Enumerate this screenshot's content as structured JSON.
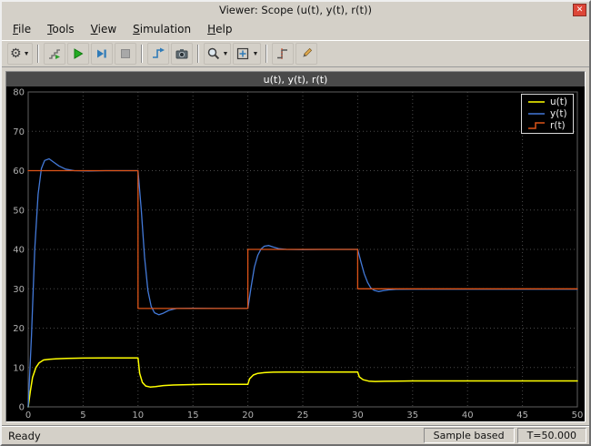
{
  "window": {
    "title": "Viewer: Scope (u(t), y(t), r(t))",
    "close_glyph": "✕"
  },
  "menu": {
    "items": [
      "File",
      "Tools",
      "View",
      "Simulation",
      "Help"
    ]
  },
  "toolbar": {
    "icons": [
      "settings-gear",
      "stepping-options",
      "run",
      "step-forward",
      "stop",
      "highlight-signal",
      "snapshot-camera",
      "zoom",
      "fit-to-view",
      "trigger",
      "cursor-measurements"
    ]
  },
  "chart_data": {
    "type": "line",
    "title": "u(t), y(t), r(t)",
    "xlim": [
      0,
      50
    ],
    "ylim": [
      0,
      80
    ],
    "xticks": [
      0,
      5,
      10,
      15,
      20,
      25,
      30,
      35,
      40,
      45,
      50
    ],
    "yticks": [
      0,
      10,
      20,
      30,
      40,
      50,
      60,
      70,
      80
    ],
    "grid": true,
    "legend_position": "top-right",
    "grid_color": "#4a4a4a",
    "tick_color": "#b0b0b0",
    "frame_color": "#5f5f5f",
    "background": "#000000",
    "series": [
      {
        "name": "u(t)",
        "color": "#ffff00",
        "width": 1.5,
        "legend_sample": "line",
        "points": [
          [
            0,
            0
          ],
          [
            0.2,
            4
          ],
          [
            0.4,
            7.5
          ],
          [
            0.7,
            10
          ],
          [
            1,
            11.2
          ],
          [
            1.4,
            11.9
          ],
          [
            1.9,
            12.1
          ],
          [
            2.5,
            12.2
          ],
          [
            3.5,
            12.3
          ],
          [
            5,
            12.4
          ],
          [
            7,
            12.45
          ],
          [
            10,
            12.45
          ],
          [
            10.15,
            8.5
          ],
          [
            10.4,
            6.2
          ],
          [
            10.7,
            5.3
          ],
          [
            11.1,
            5.05
          ],
          [
            11.6,
            5.15
          ],
          [
            12.3,
            5.4
          ],
          [
            13.2,
            5.55
          ],
          [
            14.5,
            5.65
          ],
          [
            16,
            5.7
          ],
          [
            20,
            5.7
          ],
          [
            20.15,
            7.1
          ],
          [
            20.5,
            8.1
          ],
          [
            20.9,
            8.5
          ],
          [
            21.5,
            8.7
          ],
          [
            22.3,
            8.8
          ],
          [
            23.5,
            8.85
          ],
          [
            26,
            8.85
          ],
          [
            30,
            8.85
          ],
          [
            30.15,
            7.6
          ],
          [
            30.5,
            6.9
          ],
          [
            31,
            6.55
          ],
          [
            31.6,
            6.45
          ],
          [
            32.4,
            6.5
          ],
          [
            33.5,
            6.55
          ],
          [
            35,
            6.6
          ],
          [
            40,
            6.6
          ],
          [
            45,
            6.6
          ],
          [
            50,
            6.6
          ]
        ]
      },
      {
        "name": "y(t)",
        "color": "#4379d8",
        "width": 1.3,
        "legend_sample": "line",
        "points": [
          [
            0,
            0
          ],
          [
            0.3,
            18
          ],
          [
            0.6,
            40
          ],
          [
            0.9,
            54
          ],
          [
            1.2,
            60.5
          ],
          [
            1.5,
            62.6
          ],
          [
            1.9,
            63
          ],
          [
            2.3,
            62.2
          ],
          [
            2.8,
            61.2
          ],
          [
            3.4,
            60.4
          ],
          [
            4.2,
            60
          ],
          [
            5.5,
            59.9
          ],
          [
            7,
            60
          ],
          [
            10,
            60
          ],
          [
            10.3,
            50
          ],
          [
            10.6,
            38
          ],
          [
            10.9,
            29.5
          ],
          [
            11.2,
            25.5
          ],
          [
            11.5,
            23.9
          ],
          [
            11.9,
            23.4
          ],
          [
            12.3,
            23.8
          ],
          [
            12.8,
            24.5
          ],
          [
            13.5,
            25
          ],
          [
            15,
            25.05
          ],
          [
            17,
            25
          ],
          [
            20,
            25
          ],
          [
            20.3,
            30.5
          ],
          [
            20.6,
            35.5
          ],
          [
            20.9,
            38.5
          ],
          [
            21.2,
            40.1
          ],
          [
            21.5,
            40.8
          ],
          [
            21.9,
            41
          ],
          [
            22.3,
            40.6
          ],
          [
            22.8,
            40.2
          ],
          [
            23.5,
            40
          ],
          [
            25,
            39.95
          ],
          [
            27,
            40
          ],
          [
            30,
            40
          ],
          [
            30.3,
            36.8
          ],
          [
            30.6,
            33.8
          ],
          [
            30.9,
            31.6
          ],
          [
            31.2,
            30.2
          ],
          [
            31.5,
            29.6
          ],
          [
            31.9,
            29.3
          ],
          [
            32.3,
            29.5
          ],
          [
            32.8,
            29.7
          ],
          [
            33.5,
            29.85
          ],
          [
            35,
            29.9
          ],
          [
            40,
            29.9
          ],
          [
            45,
            29.9
          ],
          [
            50,
            29.9
          ]
        ]
      },
      {
        "name": "r(t)",
        "color": "#dd5418",
        "width": 1.3,
        "legend_sample": "step",
        "points": [
          [
            0,
            60
          ],
          [
            10,
            60
          ],
          [
            10,
            25
          ],
          [
            20,
            25
          ],
          [
            20,
            40
          ],
          [
            30,
            40
          ],
          [
            30,
            30
          ],
          [
            50,
            30
          ]
        ]
      }
    ]
  },
  "status": {
    "ready": "Ready",
    "sample_mode": "Sample based",
    "time": "T=50.000"
  },
  "colors": {
    "close_button": "#dd4638",
    "window_chrome": "#d4d0c8",
    "figure_title_bg": "#4a4a4a"
  }
}
